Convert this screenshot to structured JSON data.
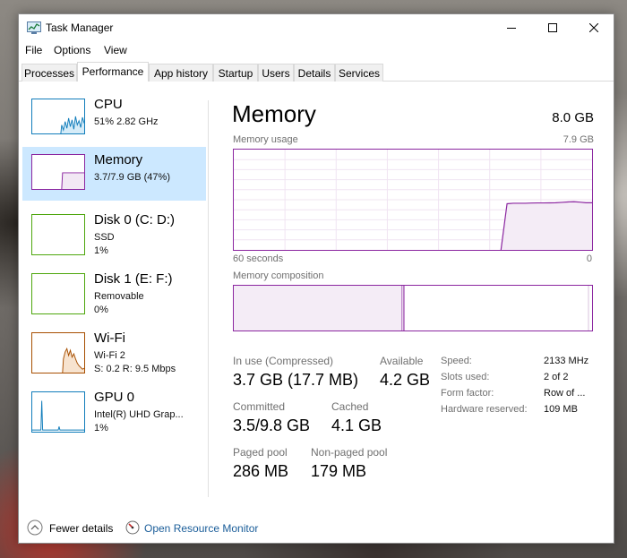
{
  "window": {
    "title": "Task Manager"
  },
  "menu": [
    "File",
    "Options",
    "View"
  ],
  "tabs": [
    "Processes",
    "Performance",
    "App history",
    "Startup",
    "Users",
    "Details",
    "Services"
  ],
  "active_tab": "Performance",
  "sidebar": [
    {
      "title": "CPU",
      "lines": [
        "51%  2.82 GHz"
      ],
      "color": "#117dbb"
    },
    {
      "title": "Memory",
      "lines": [
        "3.7/7.9 GB (47%)"
      ],
      "color": "#8b26a0"
    },
    {
      "title": "Disk 0 (C: D:)",
      "lines": [
        "SSD",
        "1%"
      ],
      "color": "#4da60c"
    },
    {
      "title": "Disk 1 (E: F:)",
      "lines": [
        "Removable",
        "0%"
      ],
      "color": "#4da60c"
    },
    {
      "title": "Wi-Fi",
      "lines": [
        "Wi-Fi 2",
        "S: 0.2  R: 9.5 Mbps"
      ],
      "color": "#a74f01"
    },
    {
      "title": "GPU 0",
      "lines": [
        "Intel(R) UHD Grap...",
        "1%"
      ],
      "color": "#117dbb"
    }
  ],
  "main": {
    "title": "Memory",
    "total": "8.0 GB",
    "usage_label": "Memory usage",
    "usage_max": "7.9 GB",
    "time_left": "60 seconds",
    "time_right": "0",
    "composition_label": "Memory composition",
    "usage_history": [
      0,
      0,
      0,
      0,
      0,
      0,
      0,
      0,
      0,
      0,
      0,
      0,
      0,
      0,
      0,
      0,
      0,
      0,
      0,
      0,
      0,
      0,
      0,
      0,
      0,
      0,
      0,
      0,
      0,
      0,
      0,
      0,
      0,
      0,
      0,
      0,
      0,
      0,
      0,
      0,
      0,
      0,
      0,
      0,
      0,
      0.46,
      0.465,
      0.465,
      0.465,
      0.467,
      0.468,
      0.468,
      0.469,
      0.47,
      0.474,
      0.478,
      0.48,
      0.476,
      0.47,
      0.47
    ],
    "composition": {
      "in_use": 0.47,
      "modified": 0.005,
      "free": 0.515
    },
    "stats": [
      {
        "label": "In use (Compressed)",
        "value": "3.7 GB (17.7 MB)"
      },
      {
        "label": "Available",
        "value": "4.2 GB"
      },
      {
        "label": "Committed",
        "value": "3.5/9.8 GB"
      },
      {
        "label": "Cached",
        "value": "4.1 GB"
      },
      {
        "label": "Paged pool",
        "value": "286 MB"
      },
      {
        "label": "Non-paged pool",
        "value": "179 MB"
      }
    ],
    "specs": [
      {
        "label": "Speed:",
        "value": "2133 MHz"
      },
      {
        "label": "Slots used:",
        "value": "2 of 2"
      },
      {
        "label": "Form factor:",
        "value": "Row of ..."
      },
      {
        "label": "Hardware reserved:",
        "value": "109 MB"
      }
    ]
  },
  "footer": {
    "fewer_details": "Fewer details",
    "resource_monitor": "Open Resource Monitor"
  },
  "accent": "#8b26a0"
}
